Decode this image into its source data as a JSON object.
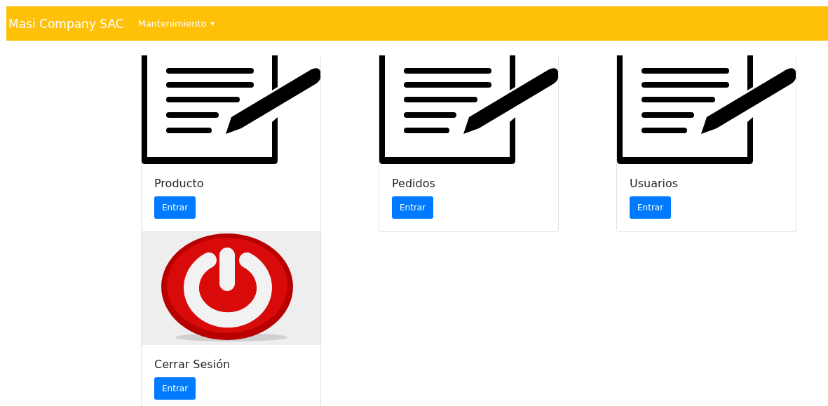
{
  "navbar": {
    "brand": "Masi Company SAC",
    "menu": {
      "label": "Mantenimiento",
      "caret": "▾"
    }
  },
  "cards": [
    {
      "kind": "document",
      "title": "Producto",
      "button": "Entrar"
    },
    {
      "kind": "document",
      "title": "Pedidos",
      "button": "Entrar"
    },
    {
      "kind": "document",
      "title": "Usuarios",
      "button": "Entrar"
    },
    {
      "kind": "power",
      "title": "Cerrar Sesión",
      "button": "Entrar"
    }
  ]
}
